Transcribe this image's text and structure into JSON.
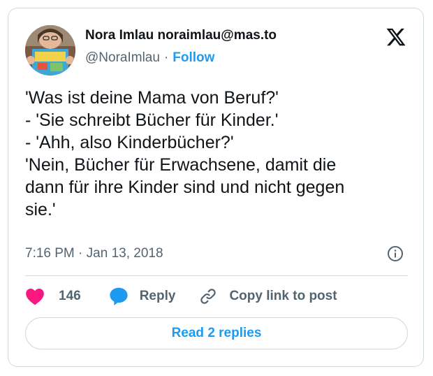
{
  "author": {
    "display_name": "Nora Imlau noraimlau@mas.to",
    "handle": "@NoraImlau",
    "separator": "·",
    "follow_label": "Follow"
  },
  "tweet": {
    "lines": [
      "'Was ist deine Mama von Beruf?'",
      "- 'Sie schreibt Bücher für Kinder.'",
      "- 'Ahh, also Kinderbücher?'",
      "'Nein, Bücher für Erwachsene, damit die",
      "dann für ihre Kinder sind und nicht gegen",
      "sie.'"
    ],
    "time": "7:16 PM",
    "date_separator": "·",
    "date": "Jan 13, 2018"
  },
  "actions": {
    "likes_count": "146",
    "reply_label": "Reply",
    "copy_link_label": "Copy link to post"
  },
  "read_replies_label": "Read 2 replies",
  "icons": {
    "platform": "x-logo-icon",
    "like": "heart-icon",
    "reply": "speech-bubble-icon",
    "copy": "link-icon",
    "info": "info-icon"
  },
  "colors": {
    "accent": "#1d9bf0",
    "like": "#f91880",
    "muted_text": "#536471",
    "border": "#cfd9de"
  }
}
